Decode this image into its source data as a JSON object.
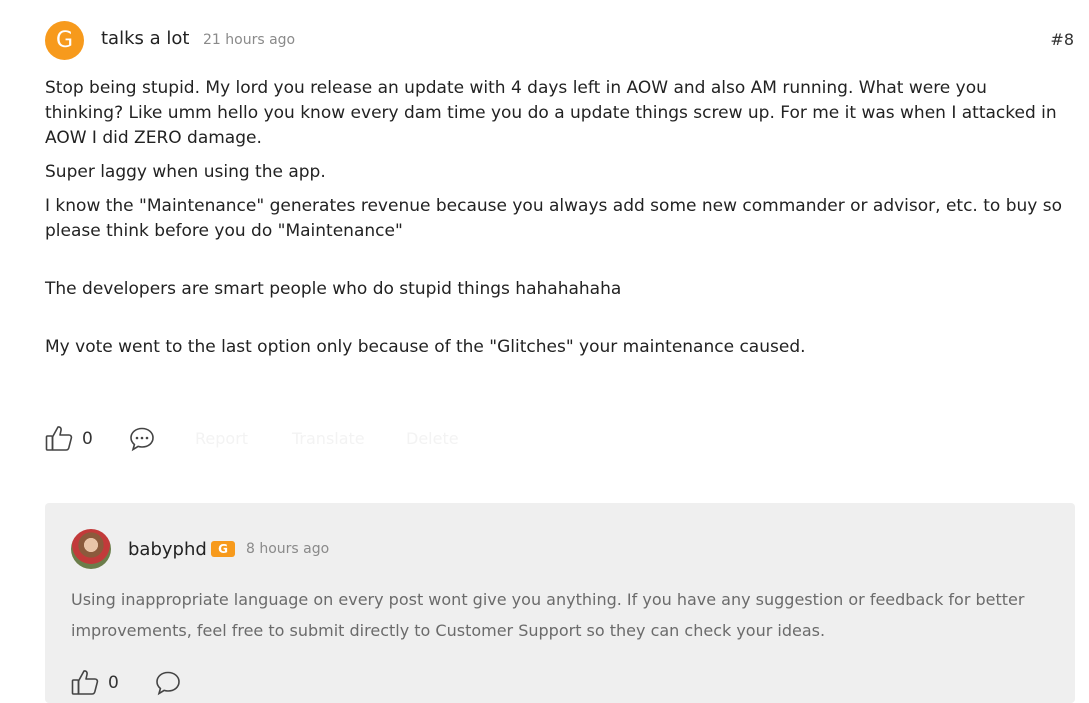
{
  "post": {
    "avatar_letter": "G",
    "author": "talks a lot",
    "time": "21 hours ago",
    "number": "#8",
    "paragraphs": [
      "Stop being stupid. My lord you release an update with 4 days left in AOW and also AM running. What were you thinking? Like umm hello you know every dam time you do a update things screw up. For me it was when I attacked in AOW I did ZERO damage.",
      "Super laggy when using the app.",
      "I know the \"Maintenance\" generates revenue because you always add some new commander or advisor, etc. to buy so please think before you do \"Maintenance\"",
      "The developers are smart people who do stupid things hahahahaha",
      "My vote went to the last option only because of the \"Glitches\" your maintenance caused."
    ],
    "like_count": "0",
    "report_label": "Report",
    "translate_label": "Translate",
    "delete_label": "Delete"
  },
  "reply": {
    "author": "babyphd",
    "badge_letter": "G",
    "time": "8 hours ago",
    "text": "Using inappropriate language on every post wont give you anything. If you have any suggestion or feedback for better improvements, feel free to submit directly to Customer Support so they can check your ideas.",
    "like_count": "0"
  },
  "colors": {
    "accent": "#f79a1c",
    "muted_text": "#8a8a8a",
    "reply_bg": "#efefef"
  }
}
